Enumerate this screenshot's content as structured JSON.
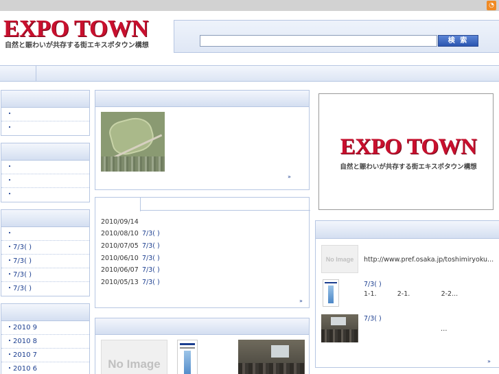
{
  "header": {
    "rss_icon": "rss-icon",
    "rss_glyph": "◔",
    "logo_title": "EXPO TOWN",
    "logo_subtitle": "自然と賑わいが共存する街エキスポタウン構想",
    "search_placeholder": "",
    "search_button": "検 索"
  },
  "sidebar": {
    "box1": [
      "・",
      "・"
    ],
    "box2": [
      "・",
      "・",
      "・"
    ],
    "box3": [
      "・",
      "・7/3( )",
      "・7/3( )",
      "・7/3( )",
      "・7/3( )"
    ],
    "box4": [
      "・2010 9",
      "・2010 8",
      "・2010 7",
      "・2010 6"
    ]
  },
  "featured": {
    "more": "»"
  },
  "news": {
    "rows": [
      {
        "date": "2010/09/14",
        "title": ""
      },
      {
        "date": "2010/08/10",
        "title": "7/3( )"
      },
      {
        "date": "2010/07/05",
        "title": "7/3( )"
      },
      {
        "date": "2010/06/10",
        "title": "7/3( )"
      },
      {
        "date": "2010/06/07",
        "title": "7/3( )"
      },
      {
        "date": "2010/05/13",
        "title": "7/3( )"
      }
    ],
    "more": "»"
  },
  "gallery": {
    "no_image": "No Image"
  },
  "banner": {
    "title": "EXPO TOWN",
    "subtitle": "自然と賑わいが共存する街エキスポタウン構想"
  },
  "links": {
    "items": [
      {
        "thumb": "No Image",
        "title": "http://www.pref.osaka.jp/toshimiryoku...",
        "desc": ""
      },
      {
        "thumb": "",
        "title": "7/3( )",
        "desc": "1-1.          2-1.               2-2..."
      },
      {
        "thumb": "",
        "title": "7/3( )",
        "desc": "…"
      }
    ],
    "more": "»"
  }
}
